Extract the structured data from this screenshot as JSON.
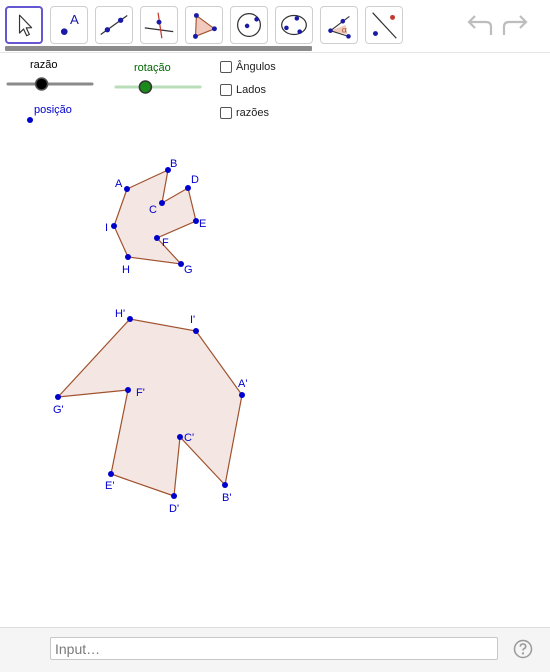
{
  "toolbar": {
    "tools": [
      {
        "id": "move",
        "icon": "arrow-pointer-icon",
        "selected": true
      },
      {
        "id": "point",
        "icon": "point-icon",
        "label": "A"
      },
      {
        "id": "line",
        "icon": "line-icon"
      },
      {
        "id": "perpendicular",
        "icon": "perpendicular-line-icon"
      },
      {
        "id": "polygon",
        "icon": "polygon-icon"
      },
      {
        "id": "circle",
        "icon": "circle-center-point-icon"
      },
      {
        "id": "conic",
        "icon": "ellipse-icon"
      },
      {
        "id": "angle",
        "icon": "angle-icon",
        "label": "α"
      },
      {
        "id": "reflect",
        "icon": "reflect-line-icon"
      }
    ],
    "undo_icon": "undo-icon",
    "redo_icon": "redo-icon"
  },
  "sliders": {
    "razao": {
      "label": "razão",
      "label_color": "#000000",
      "knob_color": "#000000",
      "value_fraction": 0.4
    },
    "rotacao": {
      "label": "rotação",
      "label_color": "#006400",
      "knob_color": "#1a8a1a",
      "value_fraction": 0.35
    }
  },
  "posicao": {
    "label": "posição",
    "color": "#0000cc"
  },
  "checkboxes": [
    {
      "label": "Ângulos",
      "checked": false
    },
    {
      "label": "Lados",
      "checked": false
    },
    {
      "label": "razões",
      "checked": false
    }
  ],
  "polygon_small": {
    "fill": "#f3e6e3",
    "stroke": "#a0522d",
    "vertices": [
      {
        "name": "A"
      },
      {
        "name": "B"
      },
      {
        "name": "C"
      },
      {
        "name": "D"
      },
      {
        "name": "E"
      },
      {
        "name": "F"
      },
      {
        "name": "G"
      },
      {
        "name": "H"
      },
      {
        "name": "I"
      }
    ]
  },
  "polygon_large": {
    "fill": "#f3e6e3",
    "stroke": "#a0522d",
    "vertices": [
      {
        "name": "A'"
      },
      {
        "name": "B'"
      },
      {
        "name": "C'"
      },
      {
        "name": "D'"
      },
      {
        "name": "E'"
      },
      {
        "name": "F'"
      },
      {
        "name": "G'"
      },
      {
        "name": "H'"
      },
      {
        "name": "I'"
      }
    ]
  },
  "point_color": "#0000cc",
  "input_bar": {
    "placeholder": "Input…",
    "help_icon": "help-icon"
  }
}
